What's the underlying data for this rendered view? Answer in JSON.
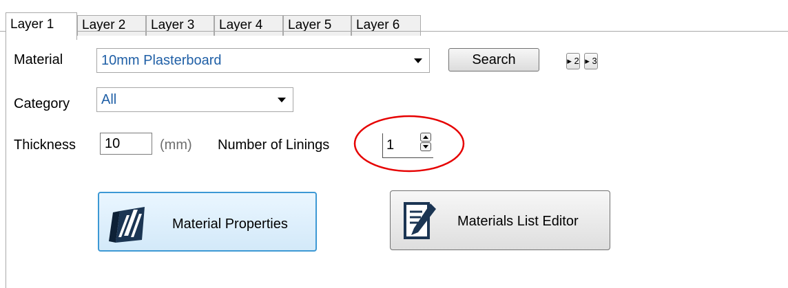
{
  "tabs": [
    {
      "label": "Layer 1",
      "active": true
    },
    {
      "label": "Layer 2",
      "active": false
    },
    {
      "label": "Layer 3",
      "active": false
    },
    {
      "label": "Layer 4",
      "active": false
    },
    {
      "label": "Layer 5",
      "active": false
    },
    {
      "label": "Layer 6",
      "active": false
    }
  ],
  "material": {
    "label": "Material",
    "value": "10mm Plasterboard",
    "search_label": "Search",
    "step2_label": "▸ 2",
    "step3_label": "▸ 3"
  },
  "category": {
    "label": "Category",
    "value": "All"
  },
  "thickness": {
    "label": "Thickness",
    "value": "10",
    "unit": "(mm)"
  },
  "linings": {
    "label": "Number of Linings",
    "value": "1"
  },
  "actions": {
    "material_properties": "Material Properties",
    "materials_list_editor": "Materials List Editor"
  },
  "icons": {
    "material_properties": "striped-block-icon",
    "materials_list_editor": "document-pen-icon"
  },
  "colors": {
    "value_text": "#1f5fa6",
    "highlight_circle": "#e60000",
    "active_button_border": "#3c98d4",
    "active_button_fill": "#d8ecfa"
  }
}
